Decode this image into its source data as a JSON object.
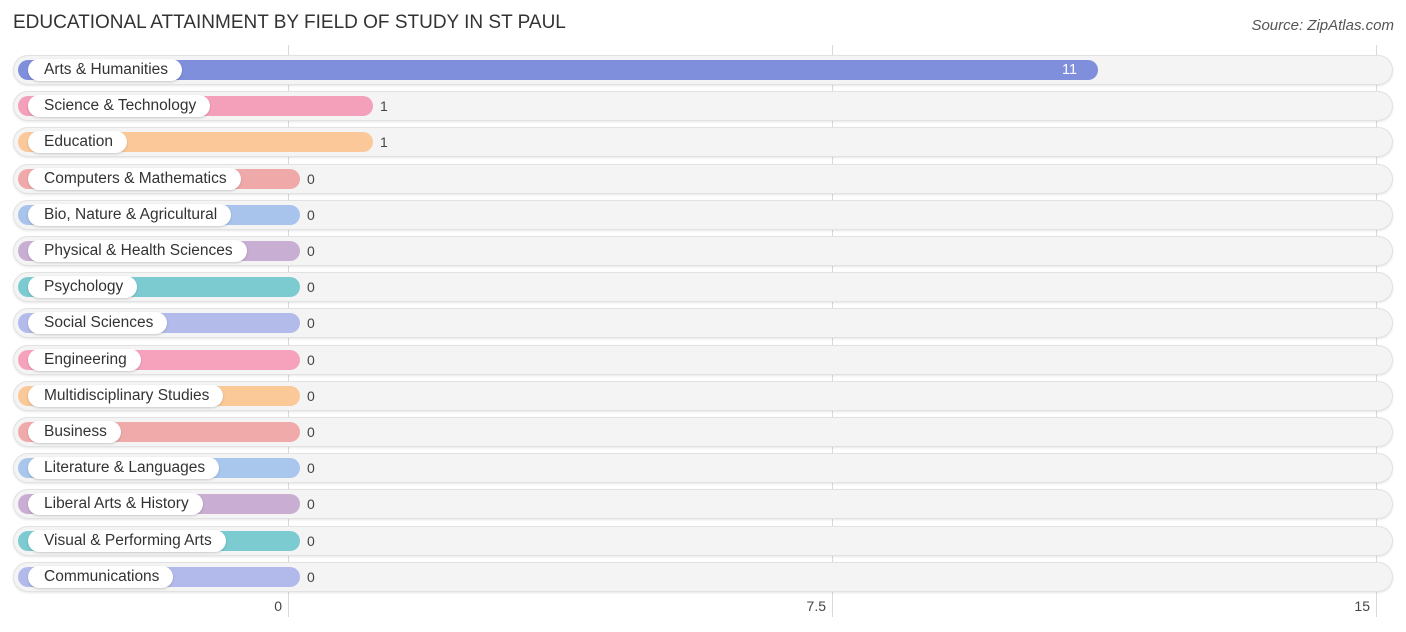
{
  "header": {
    "title": "EDUCATIONAL ATTAINMENT BY FIELD OF STUDY IN ST PAUL",
    "source": "Source: ZipAtlas.com"
  },
  "chart_data": {
    "type": "bar",
    "orientation": "horizontal",
    "title": "EDUCATIONAL ATTAINMENT BY FIELD OF STUDY IN ST PAUL",
    "xlabel": "",
    "ylabel": "",
    "xlim": [
      0,
      15
    ],
    "xticks": [
      "0",
      "7.5",
      "15"
    ],
    "xtick_values": [
      0,
      7.5,
      15
    ],
    "grid": true,
    "categories": [
      "Arts & Humanities",
      "Science & Technology",
      "Education",
      "Computers & Mathematics",
      "Bio, Nature & Agricultural",
      "Physical & Health Sciences",
      "Psychology",
      "Social Sciences",
      "Engineering",
      "Multidisciplinary Studies",
      "Business",
      "Literature & Languages",
      "Liberal Arts & History",
      "Visual & Performing Arts",
      "Communications"
    ],
    "values": [
      11,
      1,
      1,
      0,
      0,
      0,
      0,
      0,
      0,
      0,
      0,
      0,
      0,
      0,
      0
    ],
    "value_labels": [
      "11",
      "1",
      "1",
      "0",
      "0",
      "0",
      "0",
      "0",
      "0",
      "0",
      "0",
      "0",
      "0",
      "0",
      "0"
    ],
    "colors": [
      "#7f8fdc",
      "#f4a0bb",
      "#fbc89a",
      "#f0a9a9",
      "#a8c4ec",
      "#c9aed3",
      "#7ccbd1",
      "#b2bbea",
      "#f6a2bd",
      "#fbc898",
      "#f0aaaa",
      "#a9c6ec",
      "#c9add2",
      "#7bcbd0",
      "#b1baea"
    ]
  }
}
